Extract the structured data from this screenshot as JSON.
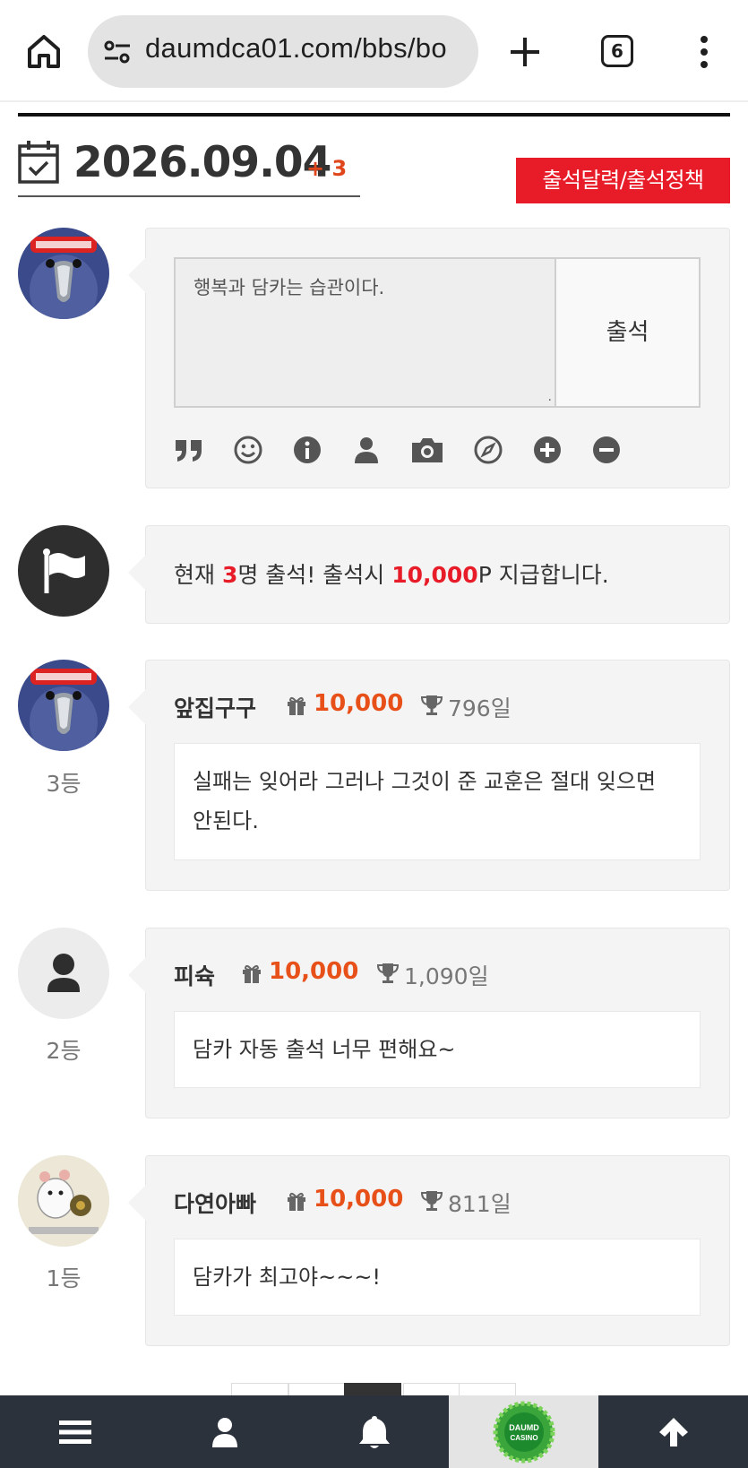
{
  "browser": {
    "url": "daumdca01.com/bbs/bo",
    "tab_count": "6"
  },
  "header": {
    "date": "2026.09.04",
    "delta": "+ 3",
    "policy_button": "출석달력/출석정책"
  },
  "composer": {
    "placeholder": "행복과 담카는 습관이다.",
    "submit_label": "출석",
    "tools": [
      "quote-icon",
      "smile-icon",
      "info-icon",
      "user-icon",
      "camera-icon",
      "compass-icon",
      "plus-circle-icon",
      "minus-circle-icon"
    ]
  },
  "notice": {
    "prefix": "현재 ",
    "count": "3",
    "middle": "명 출석! 출석시 ",
    "points": "10,000",
    "suffix": "P 지급합니다."
  },
  "entries": [
    {
      "name": "앞집구구",
      "points": "10,000",
      "days": "796일",
      "message": "실패는 잊어라 그러나 그것이 준 교훈은 절대 잊으면 안된다.",
      "rank": "3등",
      "avatar": "penguin-avatar"
    },
    {
      "name": "피슉",
      "points": "10,000",
      "days": "1,090일",
      "message": "담카 자동 출석 너무 편해요~",
      "rank": "2등",
      "avatar": "default-user-avatar"
    },
    {
      "name": "다연아빠",
      "points": "10,000",
      "days": "811일",
      "message": "담카가 최고야~~~!",
      "rank": "1등",
      "avatar": "hamster-avatar"
    }
  ],
  "bottom_nav": {
    "items": [
      "menu-icon",
      "user-icon",
      "bell-icon",
      "daum-casino-logo",
      "arrow-up-icon"
    ],
    "logo_text_1": "DAUMD",
    "logo_text_2": "CASINO"
  },
  "colors": {
    "accent_red": "#e81c28",
    "points_orange": "#e8501a",
    "nav_bg": "#2b323c"
  }
}
